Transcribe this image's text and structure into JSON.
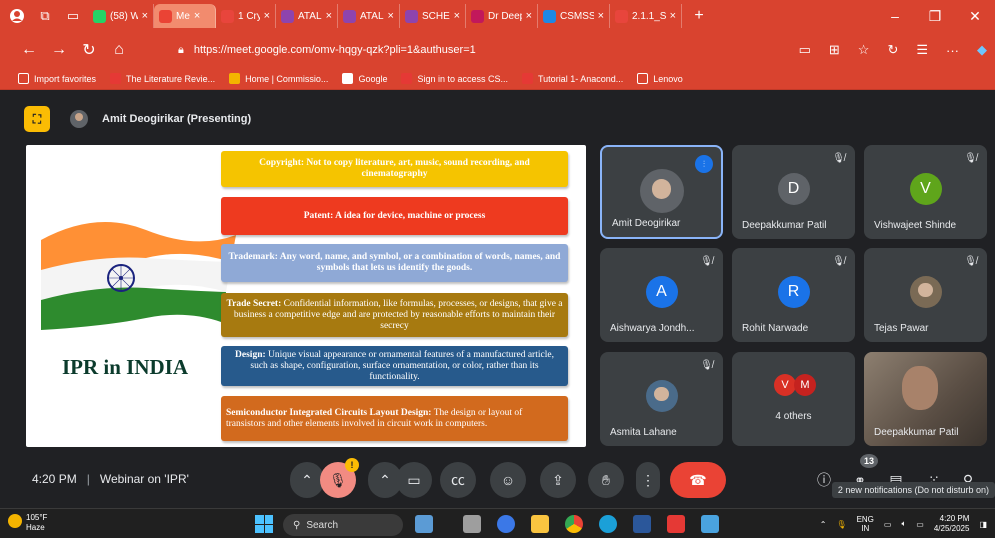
{
  "tabs": [
    {
      "label": "(58) Wh",
      "color": "#25d366",
      "active": false
    },
    {
      "label": "Me",
      "color": "#ea4335",
      "active": true
    },
    {
      "label": "1 Cryog",
      "color": "#e8453c",
      "active": false
    },
    {
      "label": "ATAL | ",
      "color": "#8e44ad",
      "active": false
    },
    {
      "label": "ATAL",
      "color": "#8e44ad",
      "active": false
    },
    {
      "label": "SCHEM",
      "color": "#8e44ad",
      "active": false
    },
    {
      "label": "Dr Deep",
      "color": "#c2185b",
      "active": false
    },
    {
      "label": "CSMSS",
      "color": "#1e88e5",
      "active": false
    },
    {
      "label": "2.1.1_Sc",
      "color": "#e8453c",
      "active": false
    }
  ],
  "address": {
    "url": "https://meet.google.com/omv-hqgy-qzk?pli=1&authuser=1"
  },
  "bookmarks": [
    {
      "label": "Import favorites",
      "icon": "folder-icon"
    },
    {
      "label": "The Literature Revie...",
      "icon": "s-icon"
    },
    {
      "label": "Home | Commissio...",
      "icon": "home-icon"
    },
    {
      "label": "Google",
      "icon": "google-icon"
    },
    {
      "label": "Sign in to access CS...",
      "icon": "s-icon"
    },
    {
      "label": "Tutorial 1- Anacond...",
      "icon": "youtube-icon"
    },
    {
      "label": "Lenovo",
      "icon": "folder-icon"
    }
  ],
  "presenter": {
    "label": "Amit Deogirikar (Presenting)"
  },
  "slide": {
    "title": "IPR in INDIA",
    "boxes": [
      {
        "head": "Copyright: Not to copy literature, art, music, sound recording, and cinematography",
        "body": "",
        "color": "#f5c400"
      },
      {
        "head": "Patent: A idea for device, machine or process",
        "body": "",
        "color": "#ee3a1f"
      },
      {
        "head": "Trademark: Any word, name, and symbol, or a combination of words, names, and symbols that lets us identify the goods.",
        "body": "",
        "color": "#8fa9d6"
      },
      {
        "head": "Trade Secret:",
        "body": " Confidential information, like formulas, processes, or designs, that give a business a competitive edge and are protected by reasonable efforts to maintain their secrecy",
        "color": "#a77a10"
      },
      {
        "head": "Design:",
        "body": " Unique visual appearance or ornamental features of a manufactured article, such as shape, configuration, surface ornamentation, or color, rather than its functionality.",
        "color": "#275a8c"
      },
      {
        "head": "Semiconductor Integrated Circuits Layout Design:",
        "body": " The design or layout of transistors and other elements involved in circuit work in computers.",
        "color": "#d26a1e"
      }
    ]
  },
  "participants": [
    {
      "name": "Amit Deogirikar",
      "initial": "",
      "color": "#5f6368",
      "active": true
    },
    {
      "name": "Deepakkumar Patil",
      "initial": "D",
      "color": "#3c4043",
      "active": false
    },
    {
      "name": "Vishwajeet Shinde",
      "initial": "V",
      "color": "#5fa51b",
      "active": false
    },
    {
      "name": "Aishwarya Jondh...",
      "initial": "A",
      "color": "#1a73e8",
      "active": false
    },
    {
      "name": "Rohit Narwade",
      "initial": "R",
      "color": "#1a73e8",
      "active": false
    },
    {
      "name": "Tejas Pawar",
      "initial": "",
      "color": "#7a6a55",
      "active": false
    },
    {
      "name": "Asmita Lahane",
      "initial": "",
      "color": "#4a6b8a",
      "active": false
    },
    {
      "name": "4 others",
      "initials": [
        "V",
        "M"
      ],
      "color": "#d93025"
    },
    {
      "name": "Deepakkumar Patil",
      "initial": "",
      "color": "#6b5d50",
      "active": false
    }
  ],
  "controls": {
    "time": "4:20 PM",
    "meeting_name": "Webinar on 'IPR'",
    "mic_badge": "!",
    "people_count": "13",
    "notification": "2 new notifications (Do not disturb on)"
  },
  "taskbar": {
    "temp": "105°F",
    "weather": "Haze",
    "search": "Search",
    "lang_top": "ENG",
    "lang_bottom": "IN",
    "clock_time": "4:20 PM",
    "clock_date": "4/25/2025"
  }
}
